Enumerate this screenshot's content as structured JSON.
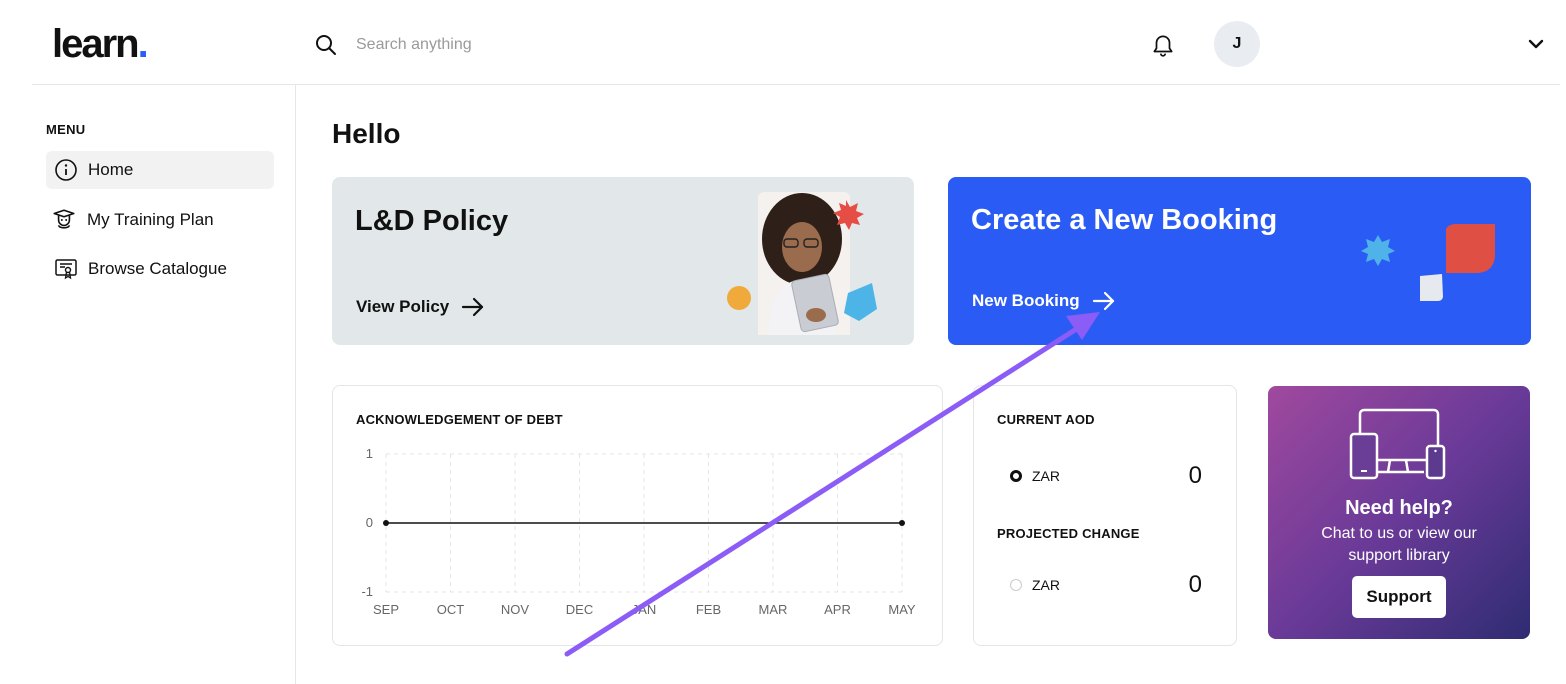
{
  "header": {
    "logo_text": "learn",
    "logo_dot": ".",
    "search_placeholder": "Search anything",
    "avatar_initial": "J"
  },
  "sidebar": {
    "menu_label": "MENU",
    "items": [
      {
        "label": "Home",
        "icon": "info-icon",
        "active": true
      },
      {
        "label": "My Training Plan",
        "icon": "graduate-icon",
        "active": false
      },
      {
        "label": "Browse Catalogue",
        "icon": "certificate-icon",
        "active": false
      }
    ]
  },
  "main": {
    "greeting": "Hello",
    "policy_card": {
      "title": "L&D Policy",
      "link": "View Policy"
    },
    "booking_card": {
      "title": "Create a New Booking",
      "link": "New Booking"
    },
    "aod_card": {
      "current_heading": "CURRENT AOD",
      "current_currency": "ZAR",
      "current_value": "0",
      "projected_heading": "PROJECTED CHANGE",
      "projected_currency": "ZAR",
      "projected_value": "0"
    },
    "help_card": {
      "title": "Need help?",
      "text": "Chat to us or view our support library",
      "button": "Support"
    }
  },
  "colors": {
    "accent": "#2a5cf5",
    "arrow": "#8b5cf6",
    "policy_bg": "#e2e8ea"
  },
  "chart_data": {
    "type": "line",
    "title": "ACKNOWLEDGEMENT OF DEBT",
    "categories": [
      "SEP",
      "OCT",
      "NOV",
      "DEC",
      "JAN",
      "FEB",
      "MAR",
      "APR",
      "MAY"
    ],
    "series": [
      {
        "values": [
          0,
          0,
          0,
          0,
          0,
          0,
          0,
          0,
          0
        ]
      }
    ],
    "yticks": [
      1,
      0,
      -1
    ],
    "ylim": [
      -1,
      1
    ],
    "grid": true
  }
}
